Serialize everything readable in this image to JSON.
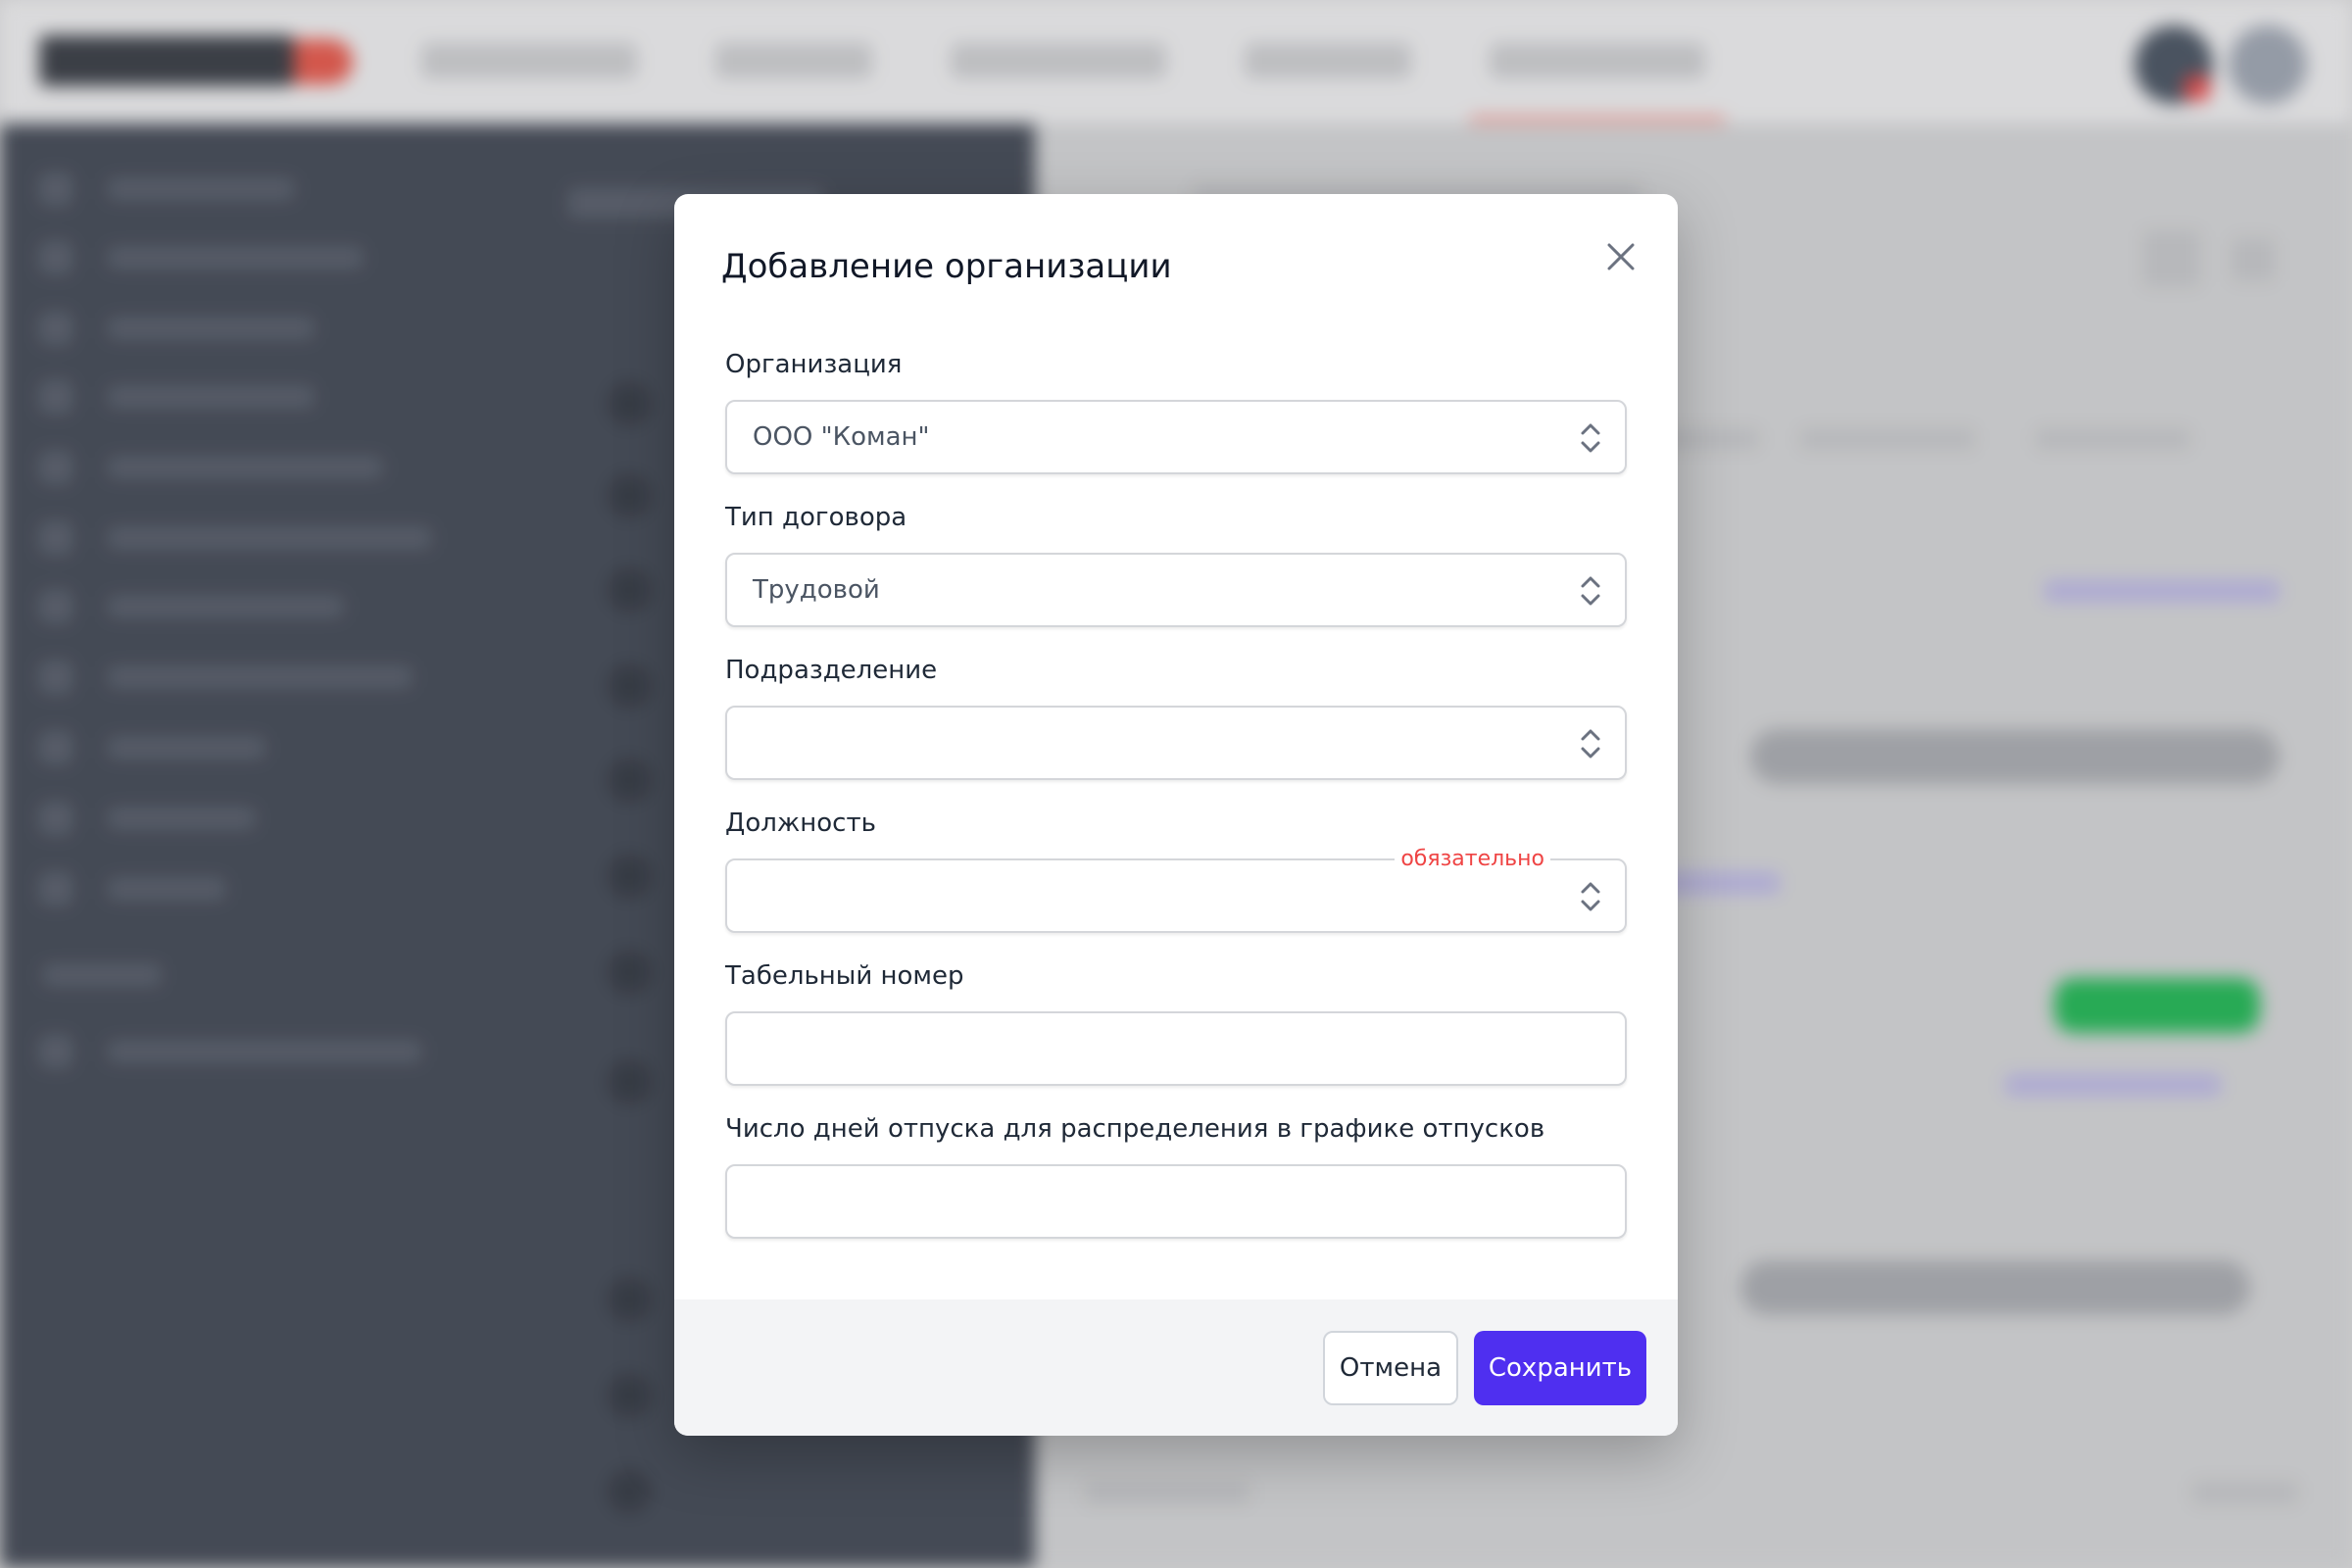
{
  "modal": {
    "title": "Добавление организации",
    "fields": [
      {
        "label": "Организация",
        "value": "ООО \"Коман\"",
        "type": "select"
      },
      {
        "label": "Тип договора",
        "value": "Трудовой",
        "type": "select"
      },
      {
        "label": "Подразделение",
        "value": "",
        "type": "select"
      },
      {
        "label": "Должность",
        "value": "",
        "type": "select",
        "required_text": "обязательно"
      },
      {
        "label": "Табельный номер",
        "value": "",
        "type": "text"
      },
      {
        "label": "Число дней отпуска для распределения в графике отпусков",
        "value": "",
        "type": "text"
      }
    ],
    "cancel_label": "Отмена",
    "save_label": "Сохранить"
  },
  "colors": {
    "primary": "#4f2ff0",
    "required": "#ef4444",
    "sidebar": "#454b57",
    "footer": "#f3f4f6"
  },
  "icons": [
    "close-icon",
    "select-chevron-icon"
  ]
}
